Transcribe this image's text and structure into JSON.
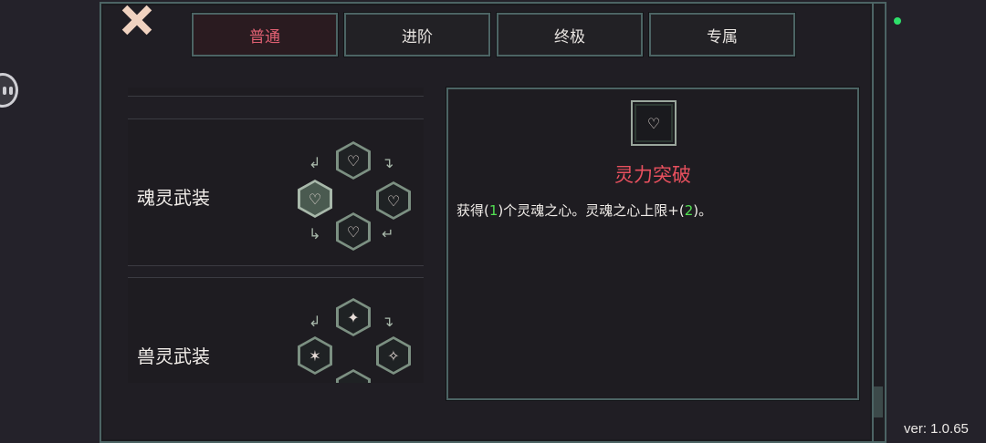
{
  "tabs": [
    {
      "label": "普通",
      "active": true
    },
    {
      "label": "进阶",
      "active": false
    },
    {
      "label": "终极",
      "active": false
    },
    {
      "label": "专属",
      "active": false
    }
  ],
  "sets": [
    {
      "name": "魂灵武装",
      "icons": [
        "soul-arms-icon",
        "broken-heart-icon",
        "heart-sword-icon",
        "soul-power-icon"
      ]
    },
    {
      "name": "兽灵武装",
      "icons": [
        "beast-paw-icon",
        "slash-icon",
        "claw-icon"
      ]
    }
  ],
  "detail": {
    "icon": "soul-power-icon",
    "title": "灵力突破",
    "desc_parts": [
      "获得(",
      "1",
      ")个灵魂之心。灵魂之心上限+(",
      "2",
      ")。"
    ]
  },
  "version": "ver: 1.0.65",
  "colors": {
    "accent_red": "#e8505e",
    "highlight_green": "#52e052",
    "frame": "#4c6464"
  }
}
